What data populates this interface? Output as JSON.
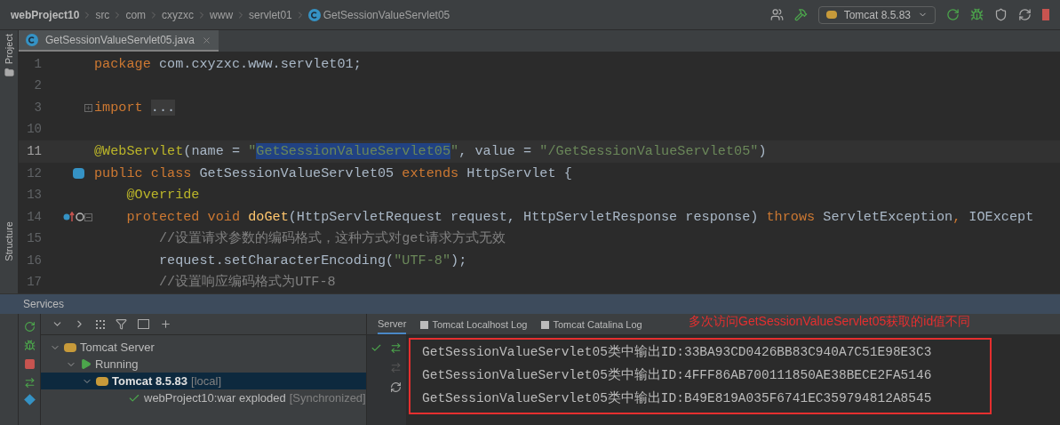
{
  "breadcrumb": [
    {
      "label": "webProject10",
      "kind": "project"
    },
    {
      "label": "src",
      "kind": "folder"
    },
    {
      "label": "com",
      "kind": "folder"
    },
    {
      "label": "cxyzxc",
      "kind": "folder"
    },
    {
      "label": "www",
      "kind": "folder"
    },
    {
      "label": "servlet01",
      "kind": "folder"
    },
    {
      "label": "GetSessionValueServlet05",
      "kind": "class"
    }
  ],
  "run_config": "Tomcat 8.5.83",
  "side_tools": [
    "Project",
    "Structure"
  ],
  "editor_tabs": [
    {
      "label": "GetSessionValueServlet05.java",
      "selected": true
    }
  ],
  "code_lines": [
    {
      "number": "1",
      "current": false,
      "kind": "top",
      "tokens": [
        {
          "text": "package ",
          "kind": "keyword"
        },
        {
          "text": "com.cxyzxc.www.servlet01;",
          "kind": "plain"
        }
      ]
    },
    {
      "number": "2",
      "current": false
    },
    {
      "number": "3",
      "current": false,
      "kind": "top",
      "folded": true,
      "tokens": [
        {
          "text": "import ",
          "kind": "keyword"
        },
        {
          "text": "...",
          "kind": "folded"
        }
      ]
    },
    {
      "number": "10",
      "current": false
    },
    {
      "number": "11",
      "current": true,
      "kind": "top",
      "tokens": [
        {
          "text": "@WebServlet",
          "kind": "annotation"
        },
        {
          "text": "(name = ",
          "kind": "plain"
        },
        {
          "text": "\"",
          "kind": "string"
        },
        {
          "text": "GetSessionValueServlet05",
          "kind": "selected"
        },
        {
          "text": "\"",
          "kind": "string"
        },
        {
          "text": ", value = ",
          "kind": "plain"
        },
        {
          "text": "\"/GetSessionValueServlet05\"",
          "kind": "string"
        },
        {
          "text": ")",
          "kind": "plain"
        }
      ]
    },
    {
      "number": "12",
      "current": false,
      "kind": "top",
      "class_marker": true,
      "tokens": [
        {
          "text": "public class ",
          "kind": "keyword"
        },
        {
          "text": "GetSessionValueServlet05 ",
          "kind": "plain"
        },
        {
          "text": "extends ",
          "kind": "keyword"
        },
        {
          "text": "HttpServlet {",
          "kind": "plain"
        }
      ]
    },
    {
      "number": "13",
      "current": false,
      "kind": "member",
      "tokens": [
        {
          "text": "@Override",
          "kind": "annotation"
        }
      ]
    },
    {
      "number": "14",
      "current": false,
      "kind": "member",
      "override_marker": true,
      "folded": false,
      "tokens": [
        {
          "text": "protected void ",
          "kind": "keyword"
        },
        {
          "text": "doGet",
          "kind": "method"
        },
        {
          "text": "(HttpServletRequest request, HttpServletResponse response) ",
          "kind": "plain"
        },
        {
          "text": "throws ",
          "kind": "keyword"
        },
        {
          "text": "ServletException",
          "kind": "plain"
        },
        {
          "text": ", ",
          "kind": "keyword"
        },
        {
          "text": "IOExcept",
          "kind": "plain"
        }
      ]
    },
    {
      "number": "15",
      "current": false,
      "kind": "body",
      "tokens": [
        {
          "text": "//设置请求参数的编码格式，这种方式对get请求方式无效",
          "kind": "comment"
        }
      ]
    },
    {
      "number": "16",
      "current": false,
      "kind": "body",
      "tokens": [
        {
          "text": "request.setCharacterEncoding(",
          "kind": "plain"
        },
        {
          "text": "\"UTF-8\"",
          "kind": "string"
        },
        {
          "text": ");",
          "kind": "plain"
        }
      ]
    },
    {
      "number": "17",
      "current": false,
      "kind": "body",
      "tokens": [
        {
          "text": "//设置响应编码格式为UTF-8",
          "kind": "comment"
        }
      ]
    }
  ],
  "services": {
    "title": "Services",
    "tree": [
      {
        "label": "Tomcat Server",
        "kind": "server",
        "expanded": true,
        "selected": false,
        "children": [
          {
            "label": "Running",
            "kind": "running",
            "expanded": true,
            "selected": false,
            "children": [
              {
                "label": "Tomcat 8.5.83",
                "note": "[local]",
                "kind": "tomcat",
                "expanded": true,
                "selected": true,
                "children": [
                  {
                    "label": "webProject10:war exploded",
                    "note": "[Synchronized]",
                    "kind": "artifact",
                    "selected": false
                  }
                ]
              }
            ]
          }
        ]
      }
    ],
    "tabs": [
      {
        "label": "Server",
        "selected": true
      },
      {
        "label": "Tomcat Localhost Log",
        "selected": false
      },
      {
        "label": "Tomcat Catalina Log",
        "selected": false
      }
    ],
    "output": [
      "GetSessionValueServlet05类中输出ID:33BA93CD0426BB83C940A7C51E98E3C3",
      "GetSessionValueServlet05类中输出ID:4FFF86AB700111850AE38BECE2FA5146",
      "GetSessionValueServlet05类中输出ID:B49E819A035F6741EC359794812A8545"
    ],
    "annotation": "多次访问GetSessionValueServlet05获取的id值不同"
  }
}
